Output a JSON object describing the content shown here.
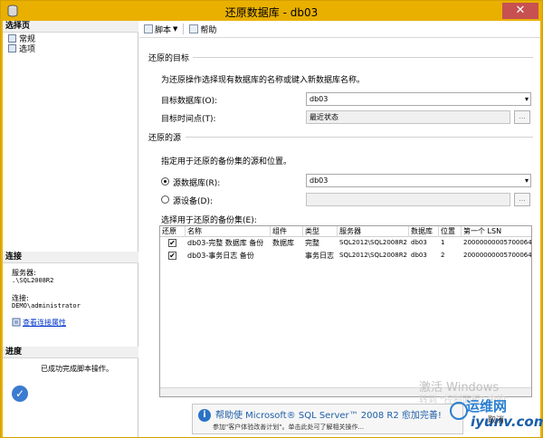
{
  "window": {
    "title": "还原数据库 - db03",
    "close_glyph": "✕"
  },
  "left": {
    "select_page_header": "选择页",
    "pages": [
      "常规",
      "选项"
    ],
    "connection_header": "连接",
    "server_label": "服务器:",
    "server_value": ".\\SQL2008R2",
    "connect_label": "连接:",
    "connect_value": "DEMO\\administrator",
    "view_props_link": "查看连接属性",
    "progress_header": "进度",
    "progress_status": "已成功完成脚本操作。"
  },
  "toolbar": {
    "script_label": "脚本",
    "help_label": "帮助"
  },
  "target": {
    "section": "还原的目标",
    "desc": "为还原操作选择现有数据库的名称或键入新数据库名称。",
    "db_label": "目标数据库(O):",
    "db_value": "db03",
    "time_label": "目标时间点(T):",
    "time_value": "最近状态",
    "browse_label": "..."
  },
  "source": {
    "section": "还原的源",
    "desc": "指定用于还原的备份集的源和位置。",
    "from_db_label": "源数据库(R):",
    "from_db_value": "db03",
    "from_device_label": "源设备(D):",
    "browse_label": "..."
  },
  "backupsets": {
    "label": "选择用于还原的备份集(E):",
    "columns": [
      "还原",
      "名称",
      "组件",
      "类型",
      "服务器",
      "数据库",
      "位置",
      "第一个 LSN"
    ],
    "rows": [
      {
        "restore": true,
        "name": "db03-完整 数据库 备份",
        "component": "数据库",
        "type": "完整",
        "server": "SQL2012\\SQL2008R2",
        "database": "db03",
        "position": "1",
        "first_lsn": "20000000005700064"
      },
      {
        "restore": true,
        "name": "db03-事务日志  备份",
        "component": "",
        "type": "事务日志",
        "server": "SQL2012\\SQL2008R2",
        "database": "db03",
        "position": "2",
        "first_lsn": "20000000005700064"
      }
    ]
  },
  "overlays": {
    "activate_1": "激活 Windows",
    "activate_2": "转到 \"控制面板\" 中的",
    "notice_title": "帮助使 Microsoft® SQL Server™ 2008 R2 愈加完善!",
    "notice_text": "参加\"客户体验改善计划\"。单击此处可了解相关操作...",
    "logo_text": "运维网",
    "site_text": "iyunv.com",
    "cancel_text": "取消"
  },
  "colors": {
    "title_bar": "#e9b000",
    "link": "#0033cc",
    "notice_title": "#1f5fa8"
  }
}
